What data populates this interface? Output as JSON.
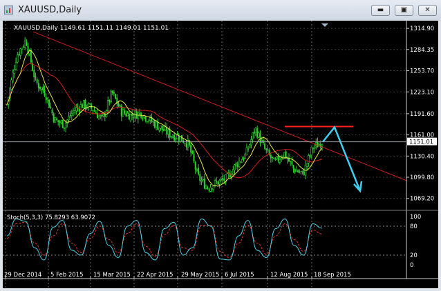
{
  "window": {
    "title": "XAUUSD,Daily",
    "min_glyph": "▬",
    "max_glyph": "▣",
    "close_glyph": "✕"
  },
  "chart_header": "XAUUSD,Daily  1149.61 1151.11 1149.01 1151.01",
  "current_price_tag": "1151.01",
  "colors": {
    "background": "#000000",
    "bull_candle": "#2fcf2f",
    "ma_fast": "#e8e84a",
    "ma_slow": "#d41d1d",
    "trendline": "#d41d1d",
    "resistance": "#ff2020",
    "projection_arrow": "#3fd0f0",
    "stoch_main": "#4fd2e6",
    "stoch_signal": "#e23030"
  },
  "stoch": {
    "label": "Stoch(5,3,3) 75.8293 63.9072",
    "scale_labels": [
      "100",
      "80",
      "20",
      "0"
    ],
    "levels": [
      100,
      80,
      20,
      0
    ]
  },
  "chart_data": {
    "type": "line",
    "title": "XAUUSD,Daily",
    "xlabel": "",
    "ylabel": "",
    "ylim": [
      1055,
      1322
    ],
    "x": [
      "29 Dec 2014",
      "5 Feb 2015",
      "15 Mar 2015",
      "22 Apr 2015",
      "29 May 2015",
      "6 Jul 2015",
      "12 Aug 2015",
      "18 Sep 2015"
    ],
    "y_ticks": [
      1314.9,
      1284.35,
      1253.7,
      1223.1,
      1191.6,
      1161.0,
      1130.4,
      1099.8,
      1069.2
    ],
    "series": [
      {
        "name": "",
        "values": [
          1205,
          1275,
          1298,
          1238,
          1222,
          1182,
          1176,
          1196,
          1205,
          1198,
          1182,
          1222,
          1194,
          1189,
          1193,
          1182,
          1172,
          1162,
          1158,
          1148,
          1100,
          1085,
          1092,
          1098,
          1118,
          1132,
          1170,
          1140,
          1120,
          1135,
          1112,
          1104,
          1142,
          1151
        ]
      }
    ],
    "annotations": [
      {
        "kind": "trendline",
        "from": [
          "22 Jan 2015",
          1310
        ],
        "to": [
          "late Oct 2015",
          1095
        ]
      },
      {
        "kind": "resistance",
        "level": 1173
      },
      {
        "kind": "projection-arrow",
        "from": 1151,
        "via": 1172,
        "to": 1080
      }
    ],
    "oscillator": {
      "name": "Stoch(5,3,3)",
      "main": [
        60,
        95,
        90,
        35,
        10,
        78,
        92,
        30,
        20,
        65,
        90,
        40,
        15,
        80,
        92,
        25,
        10,
        75,
        88,
        20,
        35,
        95,
        80,
        12,
        10,
        60,
        92,
        30,
        15,
        75,
        95,
        40,
        20,
        85,
        75.83
      ],
      "signal": [
        55,
        85,
        88,
        45,
        20,
        60,
        85,
        45,
        25,
        55,
        80,
        52,
        25,
        65,
        85,
        38,
        18,
        62,
        82,
        35,
        30,
        82,
        82,
        28,
        15,
        45,
        82,
        45,
        22,
        60,
        85,
        52,
        28,
        72,
        63.91
      ]
    }
  },
  "x_axis_labels": [
    "29 Dec 2014",
    "5 Feb 2015",
    "15 Mar 2015",
    "22 Apr 2015",
    "29 May 2015",
    "6 Jul 2015",
    "12 Aug 2015",
    "18 Sep 2015"
  ]
}
